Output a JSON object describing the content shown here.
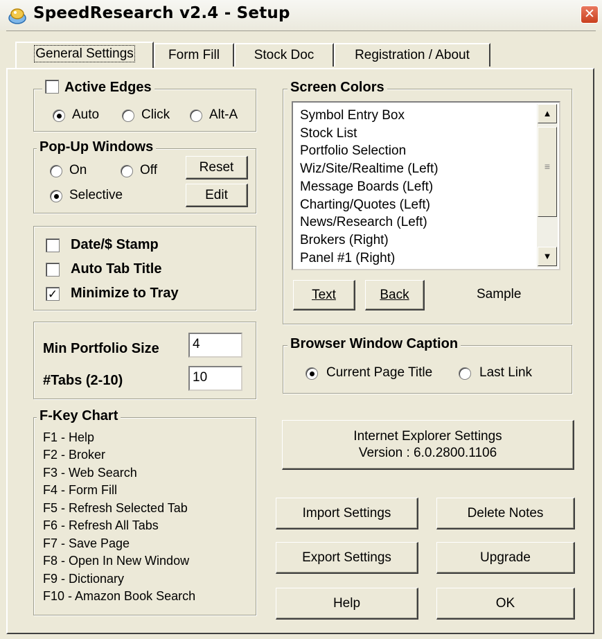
{
  "window": {
    "title": "SpeedResearch v2.4 - Setup",
    "close_glyph": "✕"
  },
  "tabs": [
    "General Settings",
    "Form Fill",
    "Stock Doc",
    "Registration / About"
  ],
  "active_edges": {
    "title": "Active Edges",
    "checked": false,
    "options": [
      "Auto",
      "Click",
      "Alt-A"
    ],
    "selected": "Auto"
  },
  "popup_windows": {
    "title": "Pop-Up Windows",
    "options": [
      "On",
      "Off",
      "Selective"
    ],
    "selected": "Selective",
    "reset_label": "Reset",
    "edit_label": "Edit"
  },
  "checks": [
    {
      "label": "Date/$ Stamp",
      "checked": false
    },
    {
      "label": "Auto Tab Title",
      "checked": false
    },
    {
      "label": "Minimize to Tray",
      "checked": true
    }
  ],
  "portfolio": {
    "min_size_label": "Min Portfolio Size",
    "min_size_value": "4",
    "tabs_label": "#Tabs (2-10)",
    "tabs_value": "10"
  },
  "fkey_chart": {
    "title": "F-Key Chart",
    "items": [
      "F1 - Help",
      "F2 - Broker",
      "F3 - Web Search",
      "F4 - Form Fill",
      "F5 - Refresh Selected Tab",
      "F6 - Refresh All Tabs",
      "F7 - Save Page",
      "F8 - Open In New Window",
      "F9 - Dictionary",
      "F10 - Amazon Book Search"
    ]
  },
  "screen_colors": {
    "title": "Screen Colors",
    "items": [
      "Symbol Entry Box",
      "Stock List",
      "Portfolio Selection",
      "Wiz/Site/Realtime (Left)",
      "Message Boards (Left)",
      "Charting/Quotes (Left)",
      "News/Research (Left)",
      "Brokers (Right)",
      "Panel #1 (Right)"
    ],
    "text_button": "Text",
    "back_button": "Back",
    "sample_label": "Sample"
  },
  "browser_caption": {
    "title": "Browser Window Caption",
    "options": [
      "Current Page Title",
      "Last Link"
    ],
    "selected": "Current Page Title"
  },
  "ie_settings": {
    "line1": "Internet Explorer Settings",
    "line2": "Version : 6.0.2800.1106"
  },
  "buttons": {
    "import": "Import Settings",
    "delete_notes": "Delete Notes",
    "export": "Export Settings",
    "upgrade": "Upgrade",
    "help": "Help",
    "ok": "OK"
  },
  "colors": {
    "background": "#ece9d8",
    "close_button": "#d6502e"
  }
}
